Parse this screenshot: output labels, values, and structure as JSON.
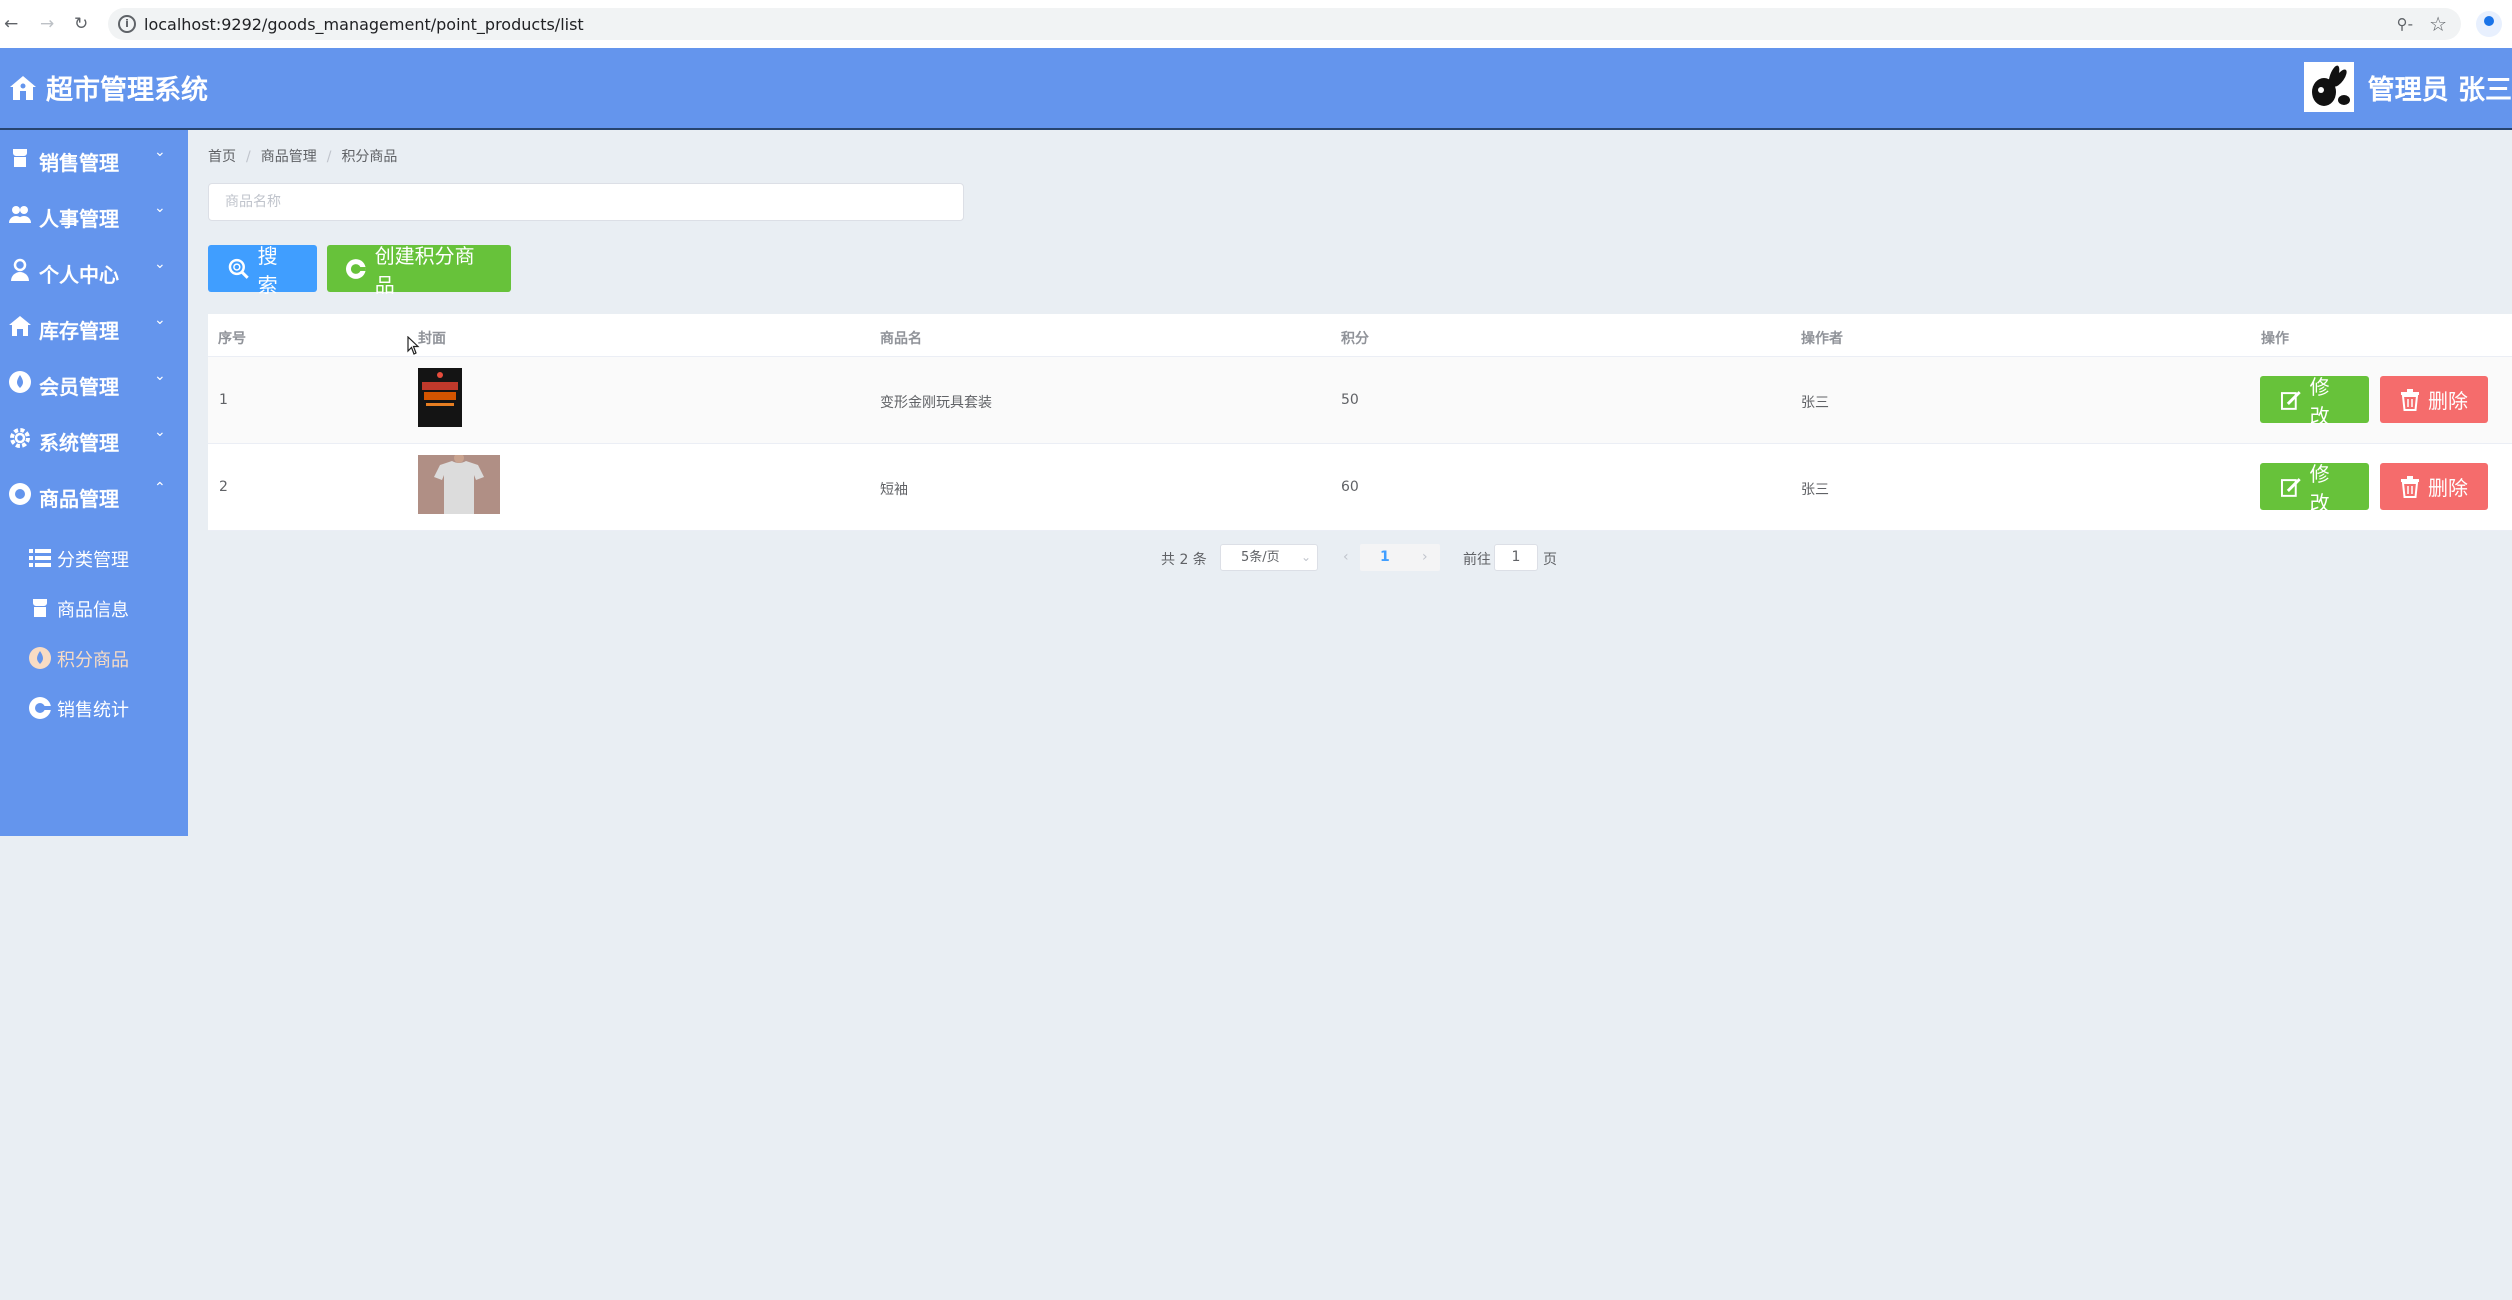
{
  "browser": {
    "url": "localhost:9292/goods_management/point_products/list",
    "back_icon": "arrow-left-icon",
    "forward_icon": "arrow-right-icon",
    "reload_icon": "reload-icon"
  },
  "header": {
    "title": "超市管理系统",
    "user": "管理员 张三"
  },
  "sidebar": {
    "items": [
      {
        "label": "销售管理",
        "icon": "sales-icon"
      },
      {
        "label": "人事管理",
        "icon": "people-icon"
      },
      {
        "label": "个人中心",
        "icon": "user-icon"
      },
      {
        "label": "库存管理",
        "icon": "warehouse-icon"
      },
      {
        "label": "会员管理",
        "icon": "member-icon"
      },
      {
        "label": "系统管理",
        "icon": "gear-icon"
      },
      {
        "label": "商品管理",
        "icon": "goods-icon",
        "expanded": true
      }
    ],
    "sub_items": [
      {
        "label": "分类管理",
        "icon": "list-icon"
      },
      {
        "label": "商品信息",
        "icon": "info-icon"
      },
      {
        "label": "积分商品",
        "icon": "points-icon",
        "active": true
      },
      {
        "label": "销售统计",
        "icon": "chart-icon"
      }
    ]
  },
  "breadcrumb": [
    "首页",
    "商品管理",
    "积分商品"
  ],
  "search": {
    "placeholder": "商品名称",
    "search_label": "搜索",
    "create_label": "创建积分商品"
  },
  "table": {
    "columns": [
      "序号",
      "封面",
      "商品名",
      "积分",
      "操作者",
      "操作"
    ],
    "rows": [
      {
        "index": "1",
        "name": "变形金刚玩具套装",
        "points": "50",
        "operator": "张三"
      },
      {
        "index": "2",
        "name": "短袖",
        "points": "60",
        "operator": "张三"
      }
    ],
    "edit_label": "修改",
    "delete_label": "删除"
  },
  "pagination": {
    "total": "共 2 条",
    "page_size": "5条/页",
    "current": "1",
    "goto_label": "前往",
    "goto_value": "1",
    "goto_suffix": "页"
  },
  "colors": {
    "header": "#6495ed",
    "primary": "#409eff",
    "success": "#67c23a",
    "danger": "#f56c6c"
  }
}
